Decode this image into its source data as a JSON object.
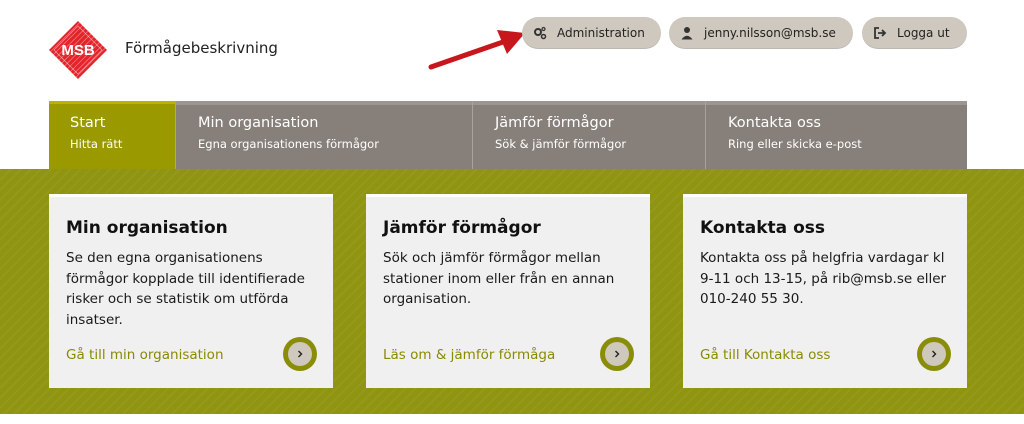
{
  "brand": {
    "logo_text": "MSB",
    "app_title": "Förmågebeskrivning",
    "logo_color": "#e3242b"
  },
  "header": {
    "admin": {
      "label": "Administration",
      "icon": "cogs-icon"
    },
    "user": {
      "label": "jenny.nilsson@msb.se",
      "icon": "user-icon"
    },
    "logout": {
      "label": "Logga ut",
      "icon": "sign-out-icon"
    }
  },
  "nav": {
    "items": [
      {
        "title": "Start",
        "subtitle": "Hitta rätt"
      },
      {
        "title": "Min organisation",
        "subtitle": "Egna organisationens förmågor"
      },
      {
        "title": "Jämför förmågor",
        "subtitle": "Sök & jämför förmågor"
      },
      {
        "title": "Kontakta oss",
        "subtitle": "Ring eller skicka e-post"
      }
    ]
  },
  "cards": [
    {
      "title": "Min organisation",
      "text": "Se den egna organisationens förmågor kopplade till identifierade risker och se statistik om utförda insatser.",
      "link": "Gå till min organisation"
    },
    {
      "title": "Jämför förmågor",
      "text": "Sök och jämför förmågor mellan stationer inom eller från en annan organisation.",
      "link": "Läs om & jämför förmåga"
    },
    {
      "title": "Kontakta oss",
      "text": "Kontakta oss på helgfria vardagar kl 9-11 och 13-15, på rib@msb.se eller 010-240 55 30.",
      "link": "Gå till Kontakta oss"
    }
  ],
  "colors": {
    "accent_olive": "#9a9a00",
    "nav_gray": "#87807a",
    "band_green": "#8f9411",
    "annotation_arrow": "#c8161d"
  }
}
